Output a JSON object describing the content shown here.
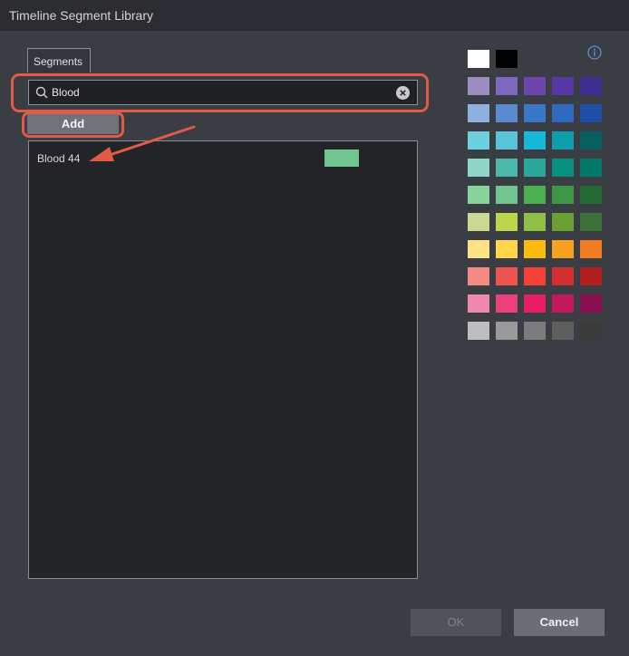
{
  "window": {
    "title": "Timeline Segment Library"
  },
  "tabs": [
    {
      "label": "Segments"
    }
  ],
  "search": {
    "value": "Blood",
    "placeholder": ""
  },
  "add_button": {
    "label": "Add"
  },
  "segments": [
    {
      "name": "Blood 44",
      "color": "#6fc48f"
    }
  ],
  "palette": {
    "rows": [
      [
        "#ffffff",
        "#000000"
      ],
      [
        "#9e8dc4",
        "#7e67bd",
        "#6a46ad",
        "#5838a6",
        "#402f92"
      ],
      [
        "#8fb1e0",
        "#5b8bcf",
        "#3a78c7",
        "#2e6bbe",
        "#1d4fa6"
      ],
      [
        "#6ccfe0",
        "#57c4d7",
        "#17b7d9",
        "#0e9eae",
        "#07605f"
      ],
      [
        "#8dd5c7",
        "#4ab8ab",
        "#2aa69a",
        "#08917e",
        "#047868"
      ],
      [
        "#86d39b",
        "#6fc48f",
        "#4caf50",
        "#3b9746",
        "#236a33"
      ],
      [
        "#c9d98f",
        "#bcd54a",
        "#8fc045",
        "#6aa135",
        "#3d7038"
      ],
      [
        "#ffe186",
        "#ffd54a",
        "#fbbb0e",
        "#f8a01f",
        "#f57b22"
      ],
      [
        "#f58b83",
        "#ef5350",
        "#f44236",
        "#d32f2f",
        "#b11d1d"
      ],
      [
        "#f288ad",
        "#ec407a",
        "#e91d63",
        "#c3185b",
        "#880e4f"
      ],
      [
        "#bdbdbd",
        "#9a9a9a",
        "#7c7c7c",
        "#5e5e5e",
        "#3b3b3b"
      ]
    ]
  },
  "footer": {
    "ok_label": "OK",
    "cancel_label": "Cancel"
  },
  "colors": {
    "annotation": "#e05a45",
    "background": "#3a3d44",
    "panel": "#222428"
  },
  "icons": [
    "search-icon",
    "clear-icon",
    "info-icon"
  ]
}
